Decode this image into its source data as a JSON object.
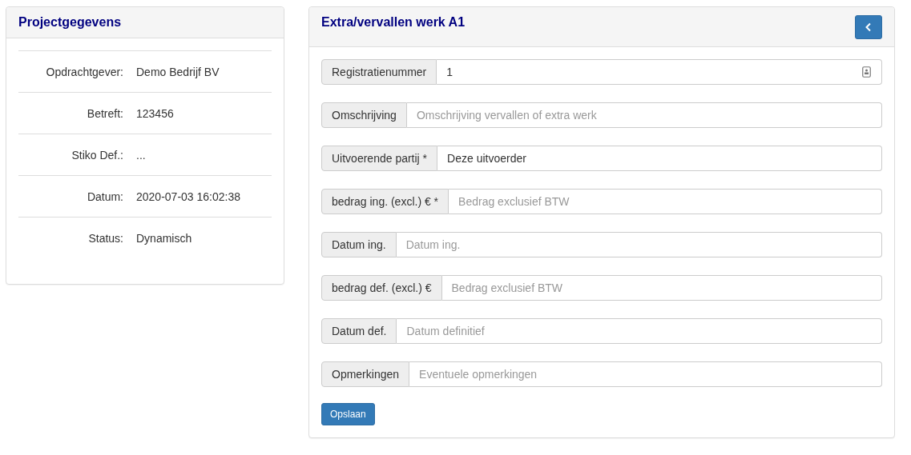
{
  "project_panel": {
    "title": "Projectgegevens",
    "rows": [
      {
        "label": "Opdrachtgever:",
        "value": "Demo Bedrijf BV"
      },
      {
        "label": "Betreft:",
        "value": "123456"
      },
      {
        "label": "Stiko Def.:",
        "value": "..."
      },
      {
        "label": "Datum:",
        "value": "2020-07-03 16:02:38"
      },
      {
        "label": "Status:",
        "value": "Dynamisch"
      }
    ]
  },
  "work_panel": {
    "title": "Extra/vervallen werk A1",
    "fields": [
      {
        "label": "Registratienummer",
        "value": "1",
        "kind": "with-icon"
      },
      {
        "label": "Omschrijving",
        "placeholder": "Omschrijving vervallen of extra werk",
        "kind": "plain"
      },
      {
        "label": "Uitvoerende partij *",
        "value": "Deze uitvoerder",
        "kind": "plain"
      },
      {
        "label": "bedrag ing. (excl.) € *",
        "placeholder": "Bedrag exclusief BTW",
        "kind": "plain"
      },
      {
        "label": "Datum ing.",
        "placeholder": "Datum ing.",
        "kind": "plain"
      },
      {
        "label": "bedrag def. (excl.) €",
        "placeholder": "Bedrag exclusief BTW",
        "kind": "plain"
      },
      {
        "label": "Datum def.",
        "placeholder": "Datum definitief",
        "kind": "plain"
      },
      {
        "label": "Opmerkingen",
        "placeholder": "Eventuele opmerkingen",
        "kind": "plain"
      }
    ],
    "save_button": "Opslaan"
  }
}
